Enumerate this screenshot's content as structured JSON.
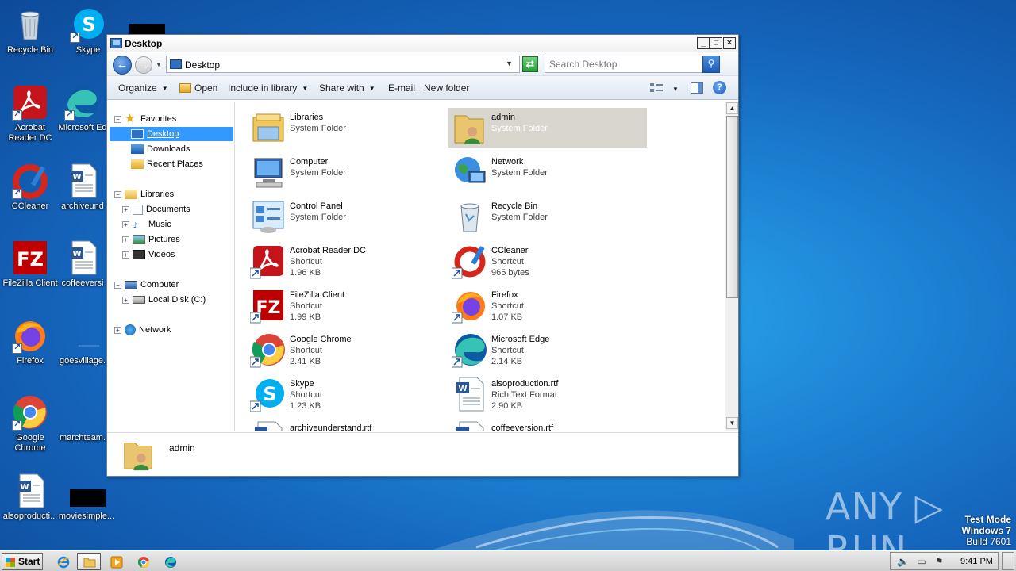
{
  "desktop": {
    "icons": [
      {
        "label": "Recycle Bin"
      },
      {
        "label": "Skype"
      },
      {
        "label": "Acrobat Reader DC"
      },
      {
        "label": "Microsoft Ed"
      },
      {
        "label": "CCleaner"
      },
      {
        "label": "archiveund"
      },
      {
        "label": "FileZilla Client"
      },
      {
        "label": "coffeeversi"
      },
      {
        "label": "Firefox"
      },
      {
        "label": "goesvillage."
      },
      {
        "label": "Google Chrome"
      },
      {
        "label": "marchteam."
      },
      {
        "label": "alsoproducti..."
      },
      {
        "label": "moviesimple..."
      }
    ]
  },
  "window": {
    "title": "Desktop",
    "minimize": "_",
    "maximize": "□",
    "close": "✕",
    "address": "Desktop",
    "search_placeholder": "Search Desktop",
    "toolbar": {
      "organize": "Organize",
      "open": "Open",
      "include_in_library": "Include in library",
      "share_with": "Share with",
      "email": "E-mail",
      "new_folder": "New folder",
      "help": "?"
    },
    "nav": {
      "favorites": "Favorites",
      "desktop": "Desktop",
      "downloads": "Downloads",
      "recent_places": "Recent Places",
      "libraries": "Libraries",
      "documents": "Documents",
      "music": "Music",
      "pictures": "Pictures",
      "videos": "Videos",
      "computer": "Computer",
      "local_disk": "Local Disk (C:)",
      "network": "Network"
    },
    "files": [
      {
        "name": "Libraries",
        "type": "System Folder",
        "size": ""
      },
      {
        "name": "admin",
        "type": "System Folder",
        "size": ""
      },
      {
        "name": "Computer",
        "type": "System Folder",
        "size": ""
      },
      {
        "name": "Network",
        "type": "System Folder",
        "size": ""
      },
      {
        "name": "Control Panel",
        "type": "System Folder",
        "size": ""
      },
      {
        "name": "Recycle Bin",
        "type": "System Folder",
        "size": ""
      },
      {
        "name": "Acrobat Reader DC",
        "type": "Shortcut",
        "size": "1.96 KB"
      },
      {
        "name": "CCleaner",
        "type": "Shortcut",
        "size": "965 bytes"
      },
      {
        "name": "FileZilla Client",
        "type": "Shortcut",
        "size": "1.99 KB"
      },
      {
        "name": "Firefox",
        "type": "Shortcut",
        "size": "1.07 KB"
      },
      {
        "name": "Google Chrome",
        "type": "Shortcut",
        "size": "2.41 KB"
      },
      {
        "name": "Microsoft Edge",
        "type": "Shortcut",
        "size": "2.14 KB"
      },
      {
        "name": "Skype",
        "type": "Shortcut",
        "size": "1.23 KB"
      },
      {
        "name": "alsoproduction.rtf",
        "type": "Rich Text Format",
        "size": "2.90 KB"
      },
      {
        "name": "archiveunderstand.rtf",
        "type": "",
        "size": ""
      },
      {
        "name": "coffeeversion.rtf",
        "type": "",
        "size": ""
      }
    ],
    "details": {
      "name": "admin"
    }
  },
  "watermark": "ANY ▷ RUN",
  "testmode": {
    "line1": "Test Mode",
    "line2": "Windows 7",
    "line3": "Build 7601"
  },
  "taskbar": {
    "start": "Start",
    "clock": "9:41 PM"
  },
  "colors": {
    "selection": "#3399ff",
    "selected_item_bg": "#d9d5cf",
    "desktop_bg": "#1e86d6"
  }
}
